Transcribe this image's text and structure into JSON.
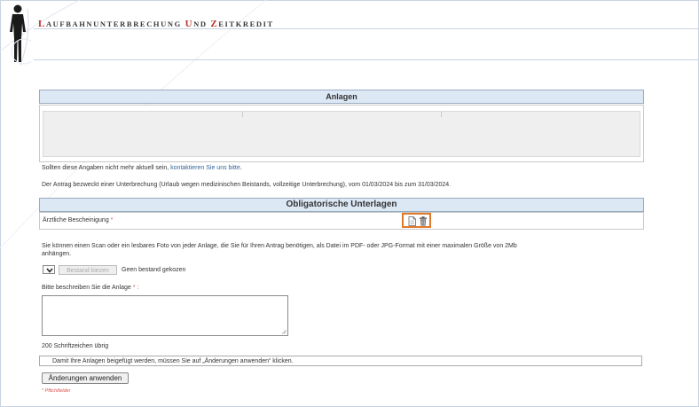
{
  "app": {
    "title_parts": [
      {
        "cap": "L",
        "rest": "AUFBAHNUNTERBRECHUNG "
      },
      {
        "cap": "U",
        "rest": "ND "
      },
      {
        "cap": "Z",
        "rest": "EITKREDIT"
      }
    ]
  },
  "anlagen": {
    "heading": "Anlagen"
  },
  "notice": {
    "prefix": "Sollten diese Angaben nicht mehr aktuell sein, ",
    "link": "kontaktieren Sie uns bitte",
    "suffix": "."
  },
  "request_text": "Der Antrag bezweckt einer Unterbrechung (Urlaub wegen medizinischen Beistands, vollzeitige Unterbrechung), vom 01/03/2024 bis zum 31/03/2024.",
  "mandatory": {
    "heading": "Obligatorische Unterlagen",
    "doc_label": "Ärztliche Bescheinigung",
    "required_mark": "*"
  },
  "upload": {
    "instructions_line1": "Sie können einen Scan oder ein lesbares Foto von jeder Anlage, die Sie für Ihren Antrag benötigen, als Datei im PDF- oder JPG-Format mit einer maximalen Größe von 2Mb",
    "instructions_line2": "anhängen.",
    "file_button": "Bestand kiezen",
    "file_status": "Geen bestand gekozen"
  },
  "describe": {
    "label": "Bitte beschreiben Sie die Anlage",
    "required_mark": "*",
    "colon": " :",
    "counter": "200 Schriftzeichen übrig"
  },
  "info_message": "Damit Ihre Anlagen beigefügt werden, müssen Sie auf „Änderungen anwenden“ klicken.",
  "apply_button": "Änderungen anwenden",
  "footnote": "* Pflichtfelder",
  "colors": {
    "accent_orange": "#e07a2b",
    "header_blue": "#dde8f5",
    "title_red": "#b8332c",
    "link": "#336699"
  },
  "icons": {
    "logo": "human-figure-icon",
    "document": "document-icon",
    "delete": "trash-icon",
    "dropdown": "chevron-down-icon"
  }
}
